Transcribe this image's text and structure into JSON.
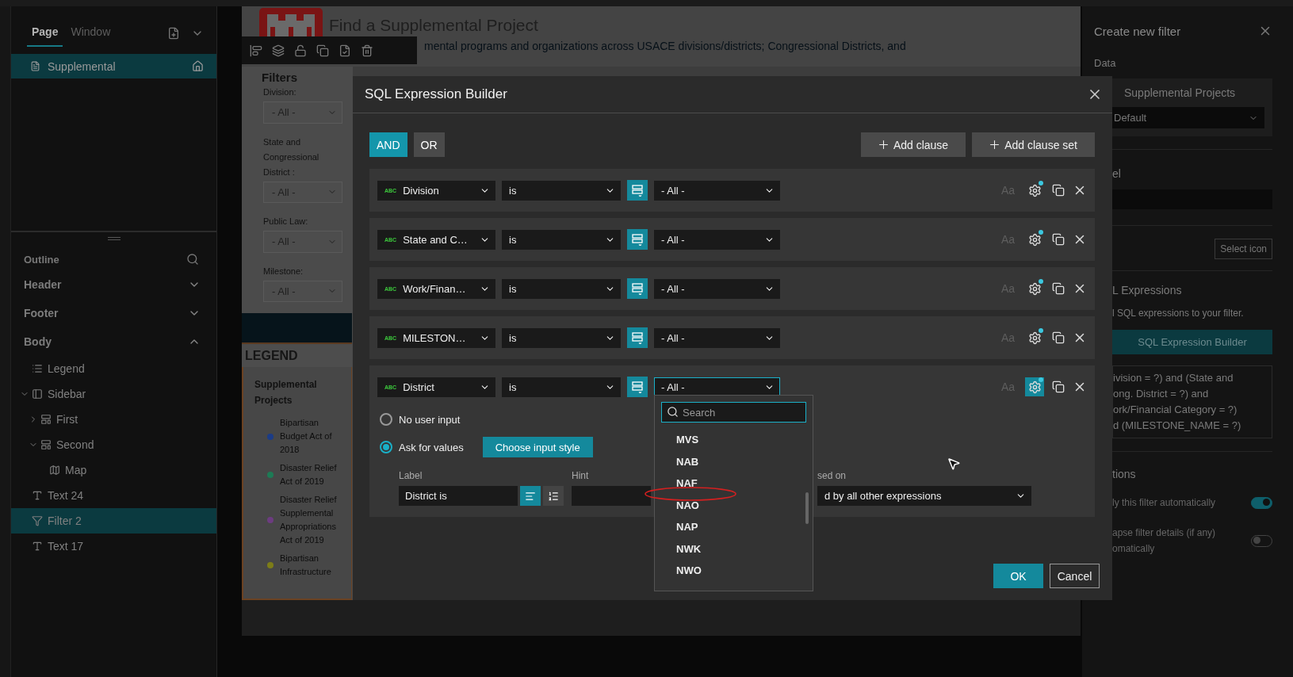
{
  "left_panel": {
    "tabs": [
      {
        "label": "Page",
        "selected": true
      },
      {
        "label": "Window",
        "selected": false
      }
    ],
    "pages": [
      {
        "label": "Supplemental",
        "selected": true
      }
    ],
    "outline": {
      "title": "Outline",
      "sections": [
        {
          "label": "Header",
          "expanded": false
        },
        {
          "label": "Footer",
          "expanded": false
        },
        {
          "label": "Body",
          "expanded": true,
          "children": [
            {
              "label": "Legend",
              "kind": "list",
              "selected": false
            },
            {
              "label": "Sidebar",
              "kind": "sidebar",
              "selected": false,
              "expanded": true,
              "children": [
                {
                  "label": "First",
                  "kind": "block",
                  "selected": false,
                  "expanded": false
                },
                {
                  "label": "Second",
                  "kind": "block",
                  "selected": false,
                  "expanded": true,
                  "children": [
                    {
                      "label": "Map",
                      "kind": "map",
                      "selected": false
                    }
                  ]
                }
              ]
            },
            {
              "label": "Text 24",
              "kind": "text",
              "selected": false
            },
            {
              "label": "Filter 2",
              "kind": "filter",
              "selected": true
            },
            {
              "label": "Text 17",
              "kind": "text",
              "selected": false
            }
          ]
        }
      ]
    }
  },
  "canvas": {
    "title": "Find a Supplemental Project",
    "subtitle": "mental programs and organizations across USACE divisions/districts; Congressional Districts, and",
    "filters_title": "Filters",
    "filters": [
      {
        "label": "Division:",
        "value": "- All -"
      },
      {
        "label": "State and Congressional District :",
        "value": "- All -"
      },
      {
        "label": "Public Law:",
        "value": "- All -"
      },
      {
        "label": "Milestone:",
        "value": "- All -"
      }
    ],
    "legend": {
      "title": "LEGEND",
      "layer": "Supplemental Projects",
      "items": [
        {
          "label": "Bipartisan Budget Act of 2018",
          "color": "#1c3c86"
        },
        {
          "label": "Disaster Relief Act of 2019",
          "color": "#1d7a55"
        },
        {
          "label": "Disaster Relief Supplemental Appropriations Act of 2019",
          "color": "#6c3c80"
        },
        {
          "label": "Bipartisan Infrastructure",
          "color": "#7d7d18"
        }
      ]
    }
  },
  "dialog": {
    "title": "SQL Expression Builder",
    "logic": [
      {
        "label": "AND",
        "selected": true
      },
      {
        "label": "OR",
        "selected": false
      }
    ],
    "actions": [
      "Add clause",
      "Add clause set"
    ],
    "clauses": [
      {
        "type_badge": "ABC",
        "field": "Division",
        "operator": "is",
        "value": "- All -",
        "case_label": "Aa",
        "active": false,
        "expanded": false
      },
      {
        "type_badge": "ABC",
        "field": "State and C…",
        "operator": "is",
        "value": "- All -",
        "case_label": "Aa",
        "active": false,
        "expanded": false
      },
      {
        "type_badge": "ABC",
        "field": "Work/Finan…",
        "operator": "is",
        "value": "- All -",
        "case_label": "Aa",
        "active": false,
        "expanded": false
      },
      {
        "type_badge": "ABC",
        "field": "MILESTON…",
        "operator": "is",
        "value": "- All -",
        "case_label": "Aa",
        "active": false,
        "expanded": false
      },
      {
        "type_badge": "ABC",
        "field": "District",
        "operator": "is",
        "value": "- All -",
        "case_label": "Aa",
        "active": true,
        "expanded": true
      }
    ],
    "details": {
      "input_modes": [
        {
          "label": "No user input",
          "selected": false
        },
        {
          "label": "Ask for values",
          "selected": true
        }
      ],
      "style_button": "Choose input style",
      "label_title": "Label",
      "label_value": "District is",
      "label_layouts": [
        {
          "kind": "inline",
          "selected": true
        },
        {
          "kind": "list",
          "selected": false
        }
      ],
      "hint_title": "Hint",
      "based_on_title": "sed on",
      "based_on_value": "d by all other expressions"
    },
    "ok": "OK",
    "cancel": "Cancel"
  },
  "value_list": {
    "placeholder": "Search",
    "options": [
      "MVS",
      "NAB",
      "NAF",
      "NAO",
      "NAP",
      "NWK",
      "NWO"
    ]
  },
  "right_panel": {
    "title": "Create new filter",
    "data_title": "Data",
    "source": "Supplemental Projects",
    "source_view": "Default",
    "label_title": "el",
    "icon_button": "Select icon",
    "sql_title": "L Expressions",
    "sql_hint": "l SQL expressions to your filter.",
    "sql_button": "SQL Expression Builder",
    "sql_lines": [
      "ivision = ?) and (State and",
      "ong. District = ?) and",
      "ork/Financial Category = ?)",
      "d (MILESTONE_NAME = ?)"
    ],
    "options_title": "tions",
    "options": [
      {
        "lines": [
          "ly this filter automatically"
        ],
        "on": true
      },
      {
        "lines": [
          "apse filter details (if any)",
          "omatically"
        ],
        "on": false
      }
    ]
  }
}
